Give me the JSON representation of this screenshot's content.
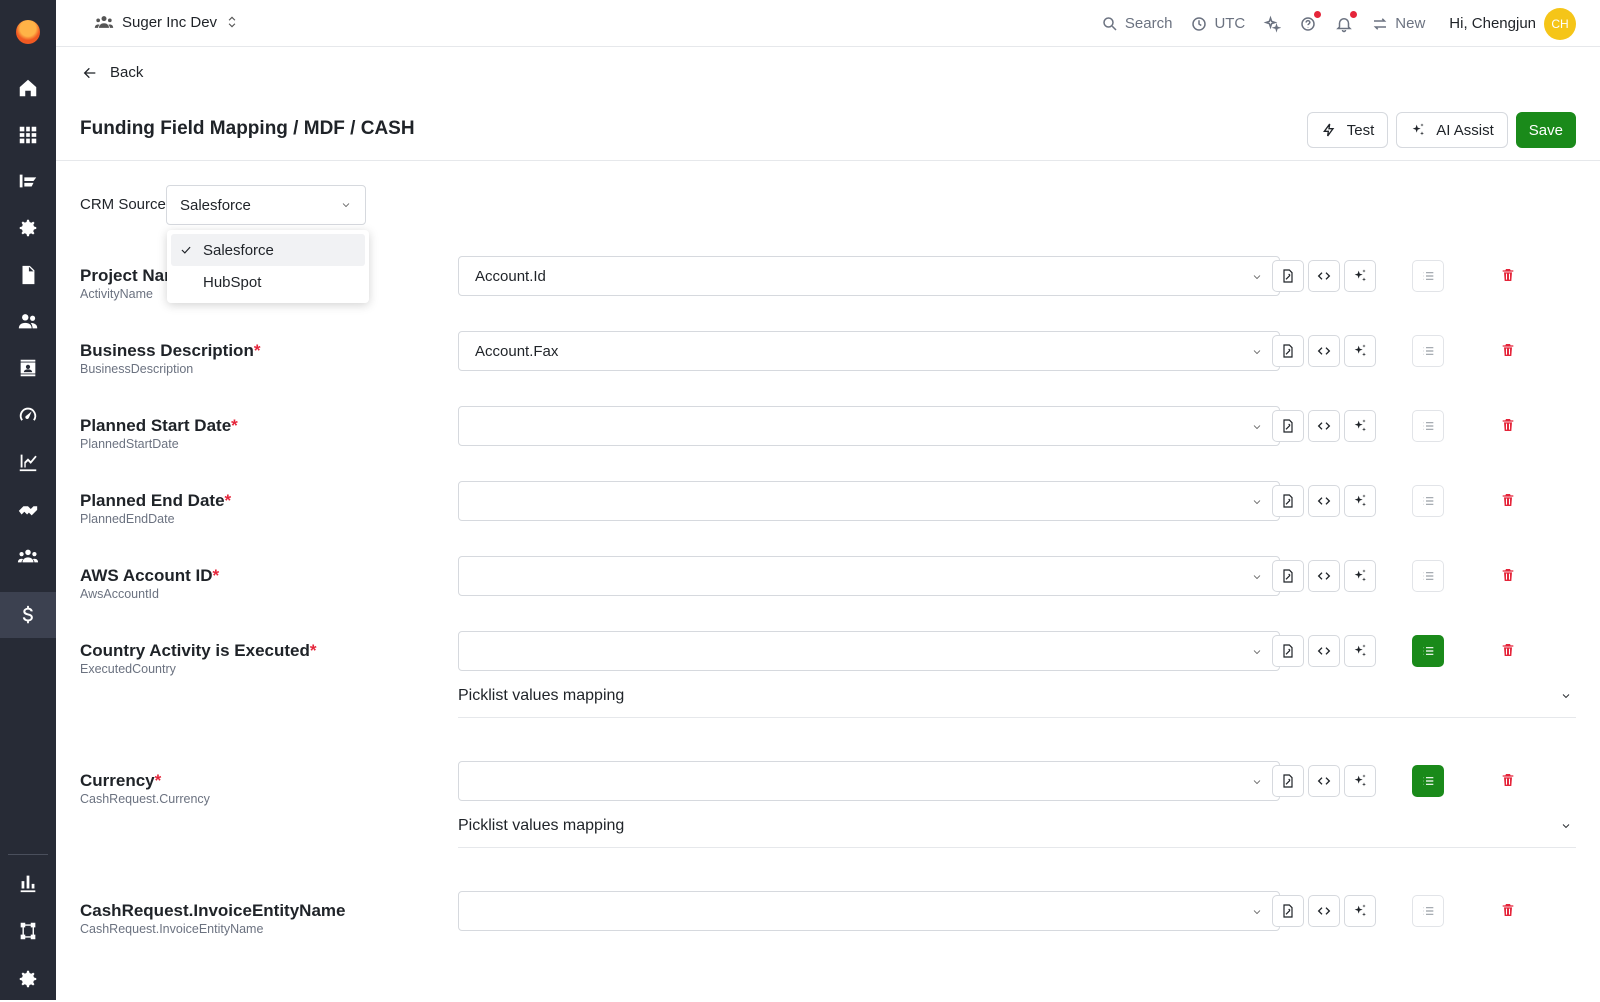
{
  "org": {
    "name": "Suger Inc Dev"
  },
  "topbar": {
    "search": "Search",
    "timezone": "UTC",
    "new": "New",
    "greeting": "Hi, Chengjun",
    "avatar_initials": "CH"
  },
  "nav": {
    "back": "Back"
  },
  "page": {
    "title": "Funding Field Mapping / MDF / CASH"
  },
  "actions": {
    "test": "Test",
    "ai_assist": "AI Assist",
    "save": "Save"
  },
  "crm": {
    "label": "CRM Source",
    "selected": "Salesforce",
    "options": [
      "Salesforce",
      "HubSpot"
    ]
  },
  "fields": [
    {
      "label": "Project Nar",
      "api": "ActivityName",
      "required": "",
      "value": "Account.Id"
    },
    {
      "label": "Business Description",
      "api": "BusinessDescription",
      "required": "*",
      "value": "Account.Fax"
    },
    {
      "label": "Planned Start Date",
      "api": "PlannedStartDate",
      "required": "*",
      "value": ""
    },
    {
      "label": "Planned End Date",
      "api": "PlannedEndDate",
      "required": "*",
      "value": ""
    },
    {
      "label": "AWS Account ID",
      "api": "AwsAccountId",
      "required": "*",
      "value": ""
    },
    {
      "label": "Country Activity is Executed",
      "api": "ExecutedCountry",
      "required": "*",
      "value": ""
    },
    {
      "label": "Currency",
      "api": "CashRequest.Currency",
      "required": "*",
      "value": ""
    },
    {
      "label": "CashRequest.InvoiceEntityName",
      "api": "CashRequest.InvoiceEntityName",
      "required": "",
      "value": ""
    }
  ],
  "picklist_label": "Picklist values mapping",
  "colors": {
    "accent": "#1a8a1a",
    "danger": "#e5253a",
    "sidebar": "#272b36",
    "avatar": "#f5c518"
  }
}
